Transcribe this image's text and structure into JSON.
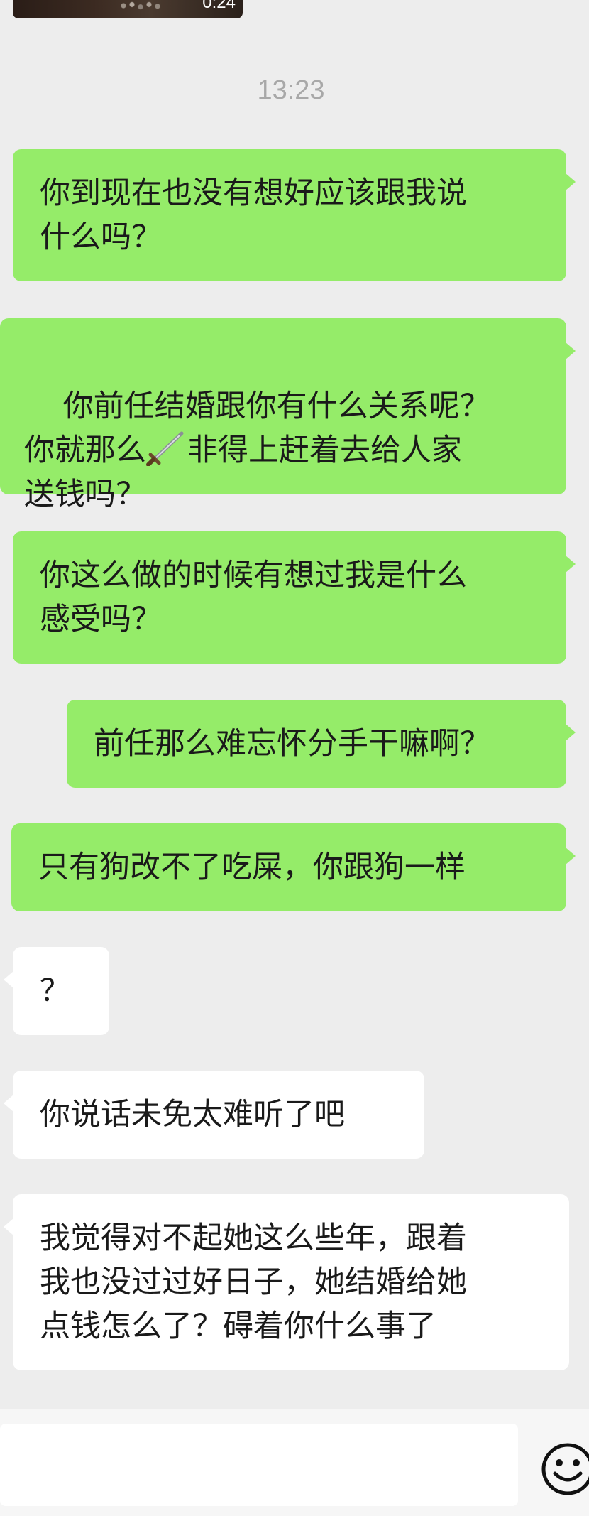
{
  "video": {
    "duration": "0:24"
  },
  "chat": {
    "timestamp": "13:23",
    "messages": [
      {
        "side": "out",
        "text": "你到现在也没有想好应该跟我说\n什么吗？"
      },
      {
        "side": "out",
        "text_before_icon": "你前任结婚跟你有什么关系呢？\n你就那么",
        "icon": "dagger-emoji",
        "text_after_icon": "非得上赶着去给人家\n送钱吗？"
      },
      {
        "side": "out",
        "text": "你这么做的时候有想过我是什么\n感受吗？"
      },
      {
        "side": "out",
        "text": "前任那么难忘怀分手干嘛啊？"
      },
      {
        "side": "out",
        "text": "只有狗改不了吃屎，你跟狗一样"
      },
      {
        "side": "in",
        "text": "？"
      },
      {
        "side": "in",
        "text": "你说话未免太难听了吧"
      },
      {
        "side": "in",
        "text": "我觉得对不起她这么些年，跟着\n我也没过过好日子，她结婚给她\n点钱怎么了？碍着你什么事了"
      }
    ]
  },
  "input": {
    "value": "",
    "emoji_icon": "smiley-face-icon"
  },
  "colors": {
    "sent_bubble": "#95ec69",
    "received_bubble": "#ffffff",
    "background": "#ededed",
    "timestamp": "#a8a8a8"
  }
}
